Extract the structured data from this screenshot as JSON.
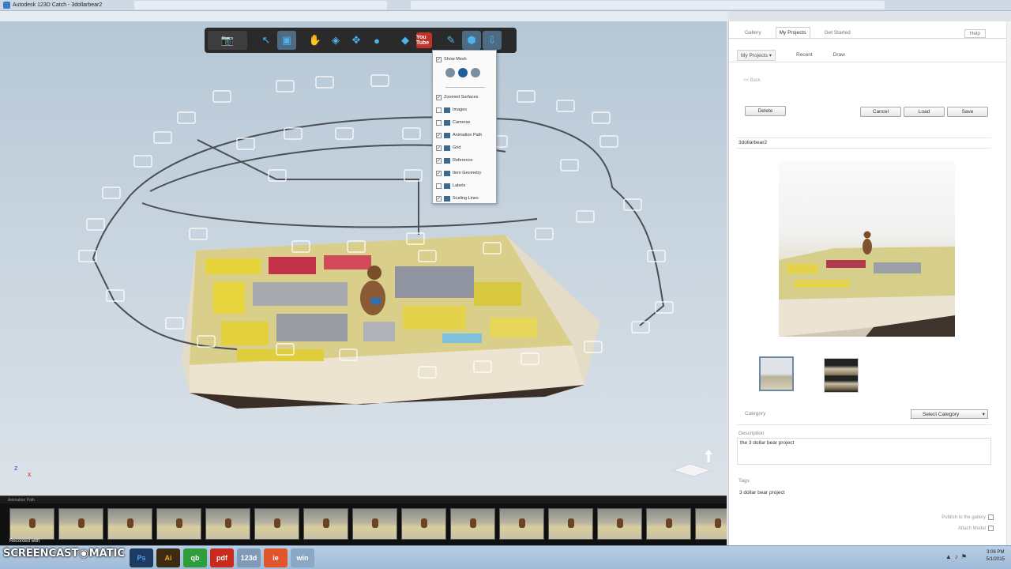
{
  "window": {
    "title": "Autodesk 123D Catch - 3dollarbear2"
  },
  "viewer": {
    "show_mesh_label": "Show Mesh",
    "view_menu": [
      {
        "label": "Zoomed Surfaces",
        "checked": true
      },
      {
        "label": "Images",
        "checked": false
      },
      {
        "label": "Cameras",
        "checked": false
      },
      {
        "label": "Animation Path",
        "checked": true
      },
      {
        "label": "Grid",
        "checked": true
      },
      {
        "label": "Reference",
        "checked": true
      },
      {
        "label": "Item Geometry",
        "checked": true
      },
      {
        "label": "Labels",
        "checked": false
      },
      {
        "label": "Scaling Lines",
        "checked": true
      }
    ],
    "axis_labels": {
      "x": "x",
      "z": "z"
    },
    "filmstrip_label": "Animation Path"
  },
  "toolbar": {
    "icons": [
      "camera-icon",
      "select-icon",
      "frame-icon",
      "orbit-icon",
      "pan-icon",
      "move-icon",
      "zoom-icon",
      "mesh-icon",
      "youtube-icon",
      "brush-icon",
      "view-options-icon",
      "export-icon"
    ],
    "youtube_label": "You Tube"
  },
  "panel": {
    "tabs": [
      "Gallery",
      "My Projects",
      "Get Started"
    ],
    "help_label": "Help",
    "subnav": [
      "My Projects",
      "Recent",
      "Draw"
    ],
    "back_label": "<< Back",
    "delete_label": "Delete",
    "cancel_label": "Cancel",
    "load_label": "Load",
    "save_label": "Save",
    "project_name": "3dollarbear2",
    "category_label": "Category",
    "category_value": "Select Category",
    "description_label": "Description",
    "description_value": "the 3 dollar bear project",
    "tags_label": "Tags",
    "tags_value": "3 dollar bear project",
    "publish_label": "Publish to the gallery",
    "attach_label": "Attach Model"
  },
  "taskbar": {
    "apps": [
      "Ps",
      "Ai",
      "qb",
      "pdf",
      "123d",
      "ie",
      "win"
    ],
    "watermark": "SCREENCAST",
    "watermark_tail": "MATIC",
    "recorded_with": "Recorded with",
    "time": "3:06 PM",
    "date": "5/1/2015"
  },
  "colors": {
    "accent": "#4fb4ee",
    "toolbar_bg": "#2a2a2a",
    "youtube": "#c0322a",
    "panel_bg": "#ffffff"
  }
}
